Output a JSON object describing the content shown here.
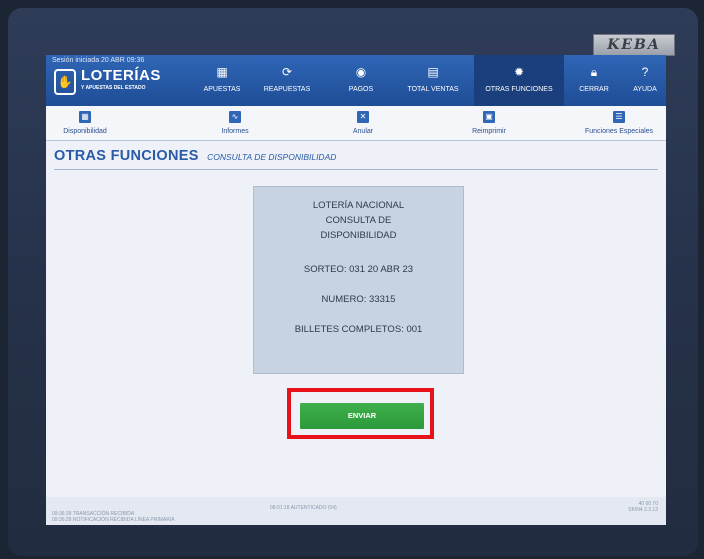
{
  "device": {
    "brand": "KEBA"
  },
  "header": {
    "session": "Sesión iniciada 20 ABR 09:36",
    "logo_title": "LOTERÍAS",
    "logo_subtitle": "Y APUESTAS DEL ESTADO"
  },
  "nav": {
    "apuestas": "APUESTAS",
    "reapuestas": "REAPUESTAS",
    "pagos": "PAGOS",
    "total_ventas": "TOTAL VENTAS",
    "otras_funciones": "OTRAS FUNCIONES",
    "cerrar": "CERRAR",
    "ayuda": "AYUDA"
  },
  "subnav": {
    "disponibilidad": "Disponibilidad",
    "informes": "Informes",
    "anular": "Anular",
    "reimprimir": "Reimprimir",
    "funciones_especiales": "Funciones Especiales"
  },
  "page": {
    "title": "OTRAS FUNCIONES",
    "subtitle": "CONSULTA DE DISPONIBILIDAD"
  },
  "info": {
    "line1": "LOTERÍA NACIONAL",
    "line2": "CONSULTA DE",
    "line3": "DISPONIBILIDAD",
    "sorteo": "SORTEO: 031 20 ABR 23",
    "numero": "NUMERO: 33315",
    "billetes": "BILLETES COMPLETOS: 001"
  },
  "actions": {
    "enviar": "ENVIAR"
  },
  "status": {
    "left1": "09:36:28 TRANSACCIÓN RECIBIDA",
    "left2": "09:36:28 NOTIFICACIÓN RECIBIDA LÍNEA PRIMARIA",
    "center": "08:01:18 AUTENTICADO (04)",
    "right1": "40 60 70",
    "right2": "SKIN4 2.3.13"
  },
  "colors": {
    "header_blue": "#2f66b6",
    "active_tab": "#1b3f7c",
    "title_blue": "#2a5aa6",
    "send_green": "#3fae4c",
    "highlight_red": "#e8121a"
  }
}
